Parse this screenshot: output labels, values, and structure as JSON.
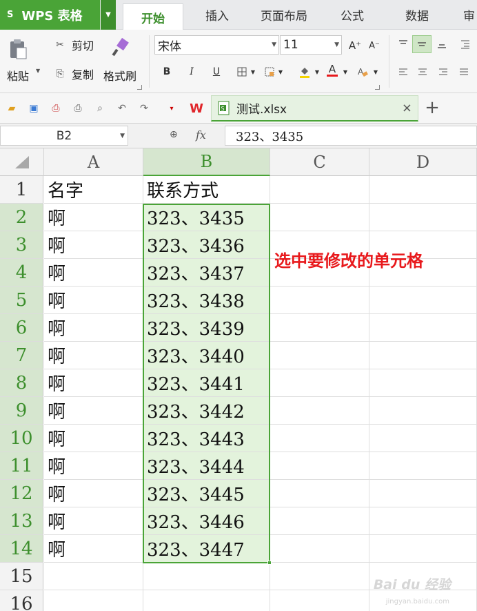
{
  "app": {
    "logo": "S",
    "name": "WPS 表格",
    "dropdown": "▼"
  },
  "tabs": [
    "开始",
    "插入",
    "页面布局",
    "公式",
    "数据",
    "审"
  ],
  "ribbon": {
    "paste": "粘贴",
    "cut": "剪切",
    "copy": "复制",
    "format_painter": "格式刷",
    "font_name": "宋体",
    "font_size": "11",
    "bold": "B",
    "italic": "I",
    "underline": "U",
    "grow_font": "A⁺",
    "shrink_font": "A⁻",
    "font_color": "A"
  },
  "document_tab": {
    "filename": "测试.xlsx",
    "close": "×",
    "new": "+"
  },
  "formula_bar": {
    "name_box": "B2",
    "fx": "fx",
    "content": "323、3435"
  },
  "columns": [
    "A",
    "B",
    "C",
    "D"
  ],
  "rows": [
    {
      "num": "1",
      "a": "名字",
      "b": "联系方式"
    },
    {
      "num": "2",
      "a": "啊",
      "b": "323、3435"
    },
    {
      "num": "3",
      "a": "啊",
      "b": "323、3436"
    },
    {
      "num": "4",
      "a": "啊",
      "b": "323、3437"
    },
    {
      "num": "5",
      "a": "啊",
      "b": "323、3438"
    },
    {
      "num": "6",
      "a": "啊",
      "b": "323、3439"
    },
    {
      "num": "7",
      "a": "啊",
      "b": "323、3440"
    },
    {
      "num": "8",
      "a": "啊",
      "b": "323、3441"
    },
    {
      "num": "9",
      "a": "啊",
      "b": "323、3442"
    },
    {
      "num": "10",
      "a": "啊",
      "b": "323、3443"
    },
    {
      "num": "11",
      "a": "啊",
      "b": "323、3444"
    },
    {
      "num": "12",
      "a": "啊",
      "b": "323、3445"
    },
    {
      "num": "13",
      "a": "啊",
      "b": "323、3446"
    },
    {
      "num": "14",
      "a": "啊",
      "b": "323、3447"
    },
    {
      "num": "15",
      "a": "",
      "b": ""
    },
    {
      "num": "16",
      "a": "",
      "b": ""
    }
  ],
  "selected": {
    "column": "B",
    "first_row": 2,
    "last_row": 14
  },
  "annotation": "选中要修改的单元格",
  "watermark": {
    "brand": "Bai du 经验",
    "url": "jingyan.baidu.com"
  },
  "colors": {
    "accent": "#4aa437",
    "selection_fill": "#e3f3dc",
    "annotation": "#e8191c"
  }
}
